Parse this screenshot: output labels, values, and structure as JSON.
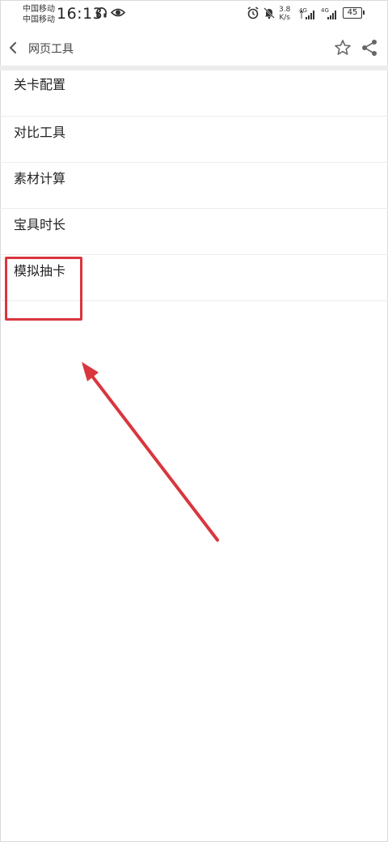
{
  "status_bar": {
    "carrier_1": "中国移动",
    "carrier_2": "中国移动",
    "time": "16:13",
    "net_speed_value": "3.8",
    "net_speed_unit": "K/s",
    "signal_1_label": "4G",
    "signal_2_label": "4G",
    "battery": "45",
    "icons": [
      "headphones-icon",
      "eye-icon",
      "alarm-icon",
      "bell-off-icon",
      "signal-icon",
      "battery-icon"
    ]
  },
  "header": {
    "title": "网页工具",
    "icons": [
      "back-icon",
      "star-icon",
      "share-icon"
    ]
  },
  "list": {
    "items": [
      {
        "label": "关卡配置"
      },
      {
        "label": "对比工具"
      },
      {
        "label": "素材计算"
      },
      {
        "label": "宝具时长"
      },
      {
        "label": "模拟抽卡"
      }
    ]
  },
  "annotation": {
    "color": "#d9363e",
    "highlighted_item": "模拟抽卡"
  }
}
